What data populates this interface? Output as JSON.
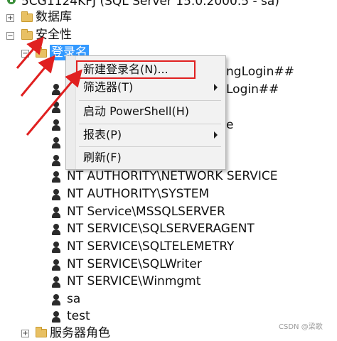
{
  "tree": {
    "server_node": "5CG1124KFJ (SQL Server 15.0.2000.5 - sa)",
    "databases": "数据库",
    "security": "安全性",
    "logins": "登录名",
    "server_roles": "服务器角色",
    "partial_right_1": "ngLogin##",
    "partial_right_2": "Login##",
    "partial_right_3": "e",
    "expand_plus": "+",
    "expand_minus": "−",
    "login_items": [
      "NT AUTHORITY\\NETWORK SERVICE",
      "NT AUTHORITY\\SYSTEM",
      "NT Service\\MSSQLSERVER",
      "NT SERVICE\\SQLSERVERAGENT",
      "NT SERVICE\\SQLTELEMETRY",
      "NT SERVICE\\SQLWriter",
      "NT SERVICE\\Winmgmt",
      "sa",
      "test"
    ]
  },
  "context_menu": {
    "new_login": "新建登录名(N)...",
    "filter": "筛选器(T)",
    "start_powershell": "启动 PowerShell(H)",
    "reports": "报表(P)",
    "refresh": "刷新(F)"
  },
  "watermark": "CSDN @梁歌",
  "colors": {
    "selection": "#3399ff",
    "annotation_red": "#e02020",
    "menu_bg": "#f2f2f2"
  }
}
